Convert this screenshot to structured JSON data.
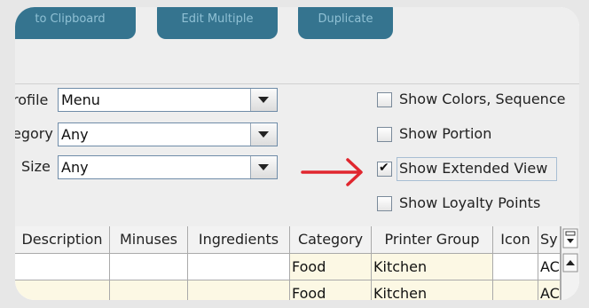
{
  "toolbar": {
    "buttons": [
      "to Clipboard",
      "Edit Multiple",
      "Duplicate"
    ]
  },
  "filters": [
    {
      "label": "rofile",
      "value": "Menu"
    },
    {
      "label": "egory",
      "value": "Any"
    },
    {
      "label": "Size",
      "value": "Any"
    }
  ],
  "options": [
    {
      "label": "Show Colors, Sequence",
      "checked": false
    },
    {
      "label": "Show Portion",
      "checked": false
    },
    {
      "label": "Show Extended View",
      "checked": true
    },
    {
      "label": "Show Loyalty Points",
      "checked": false
    }
  ],
  "check_mark": "✔",
  "annotation": {
    "color": "#e0262e"
  },
  "table": {
    "columns": [
      "Description",
      "Minuses",
      "Ingredients",
      "Category",
      "Printer Group",
      "Icon",
      "Sy"
    ],
    "rows": [
      [
        "",
        "",
        "",
        "Food",
        "Kitchen",
        "",
        "AC"
      ],
      [
        "",
        "",
        "",
        "Food",
        "Kitchen",
        "",
        "AC"
      ]
    ]
  },
  "colors": {
    "toolbar_button": "#35748f",
    "row_highlight": "#fcf8e4"
  }
}
